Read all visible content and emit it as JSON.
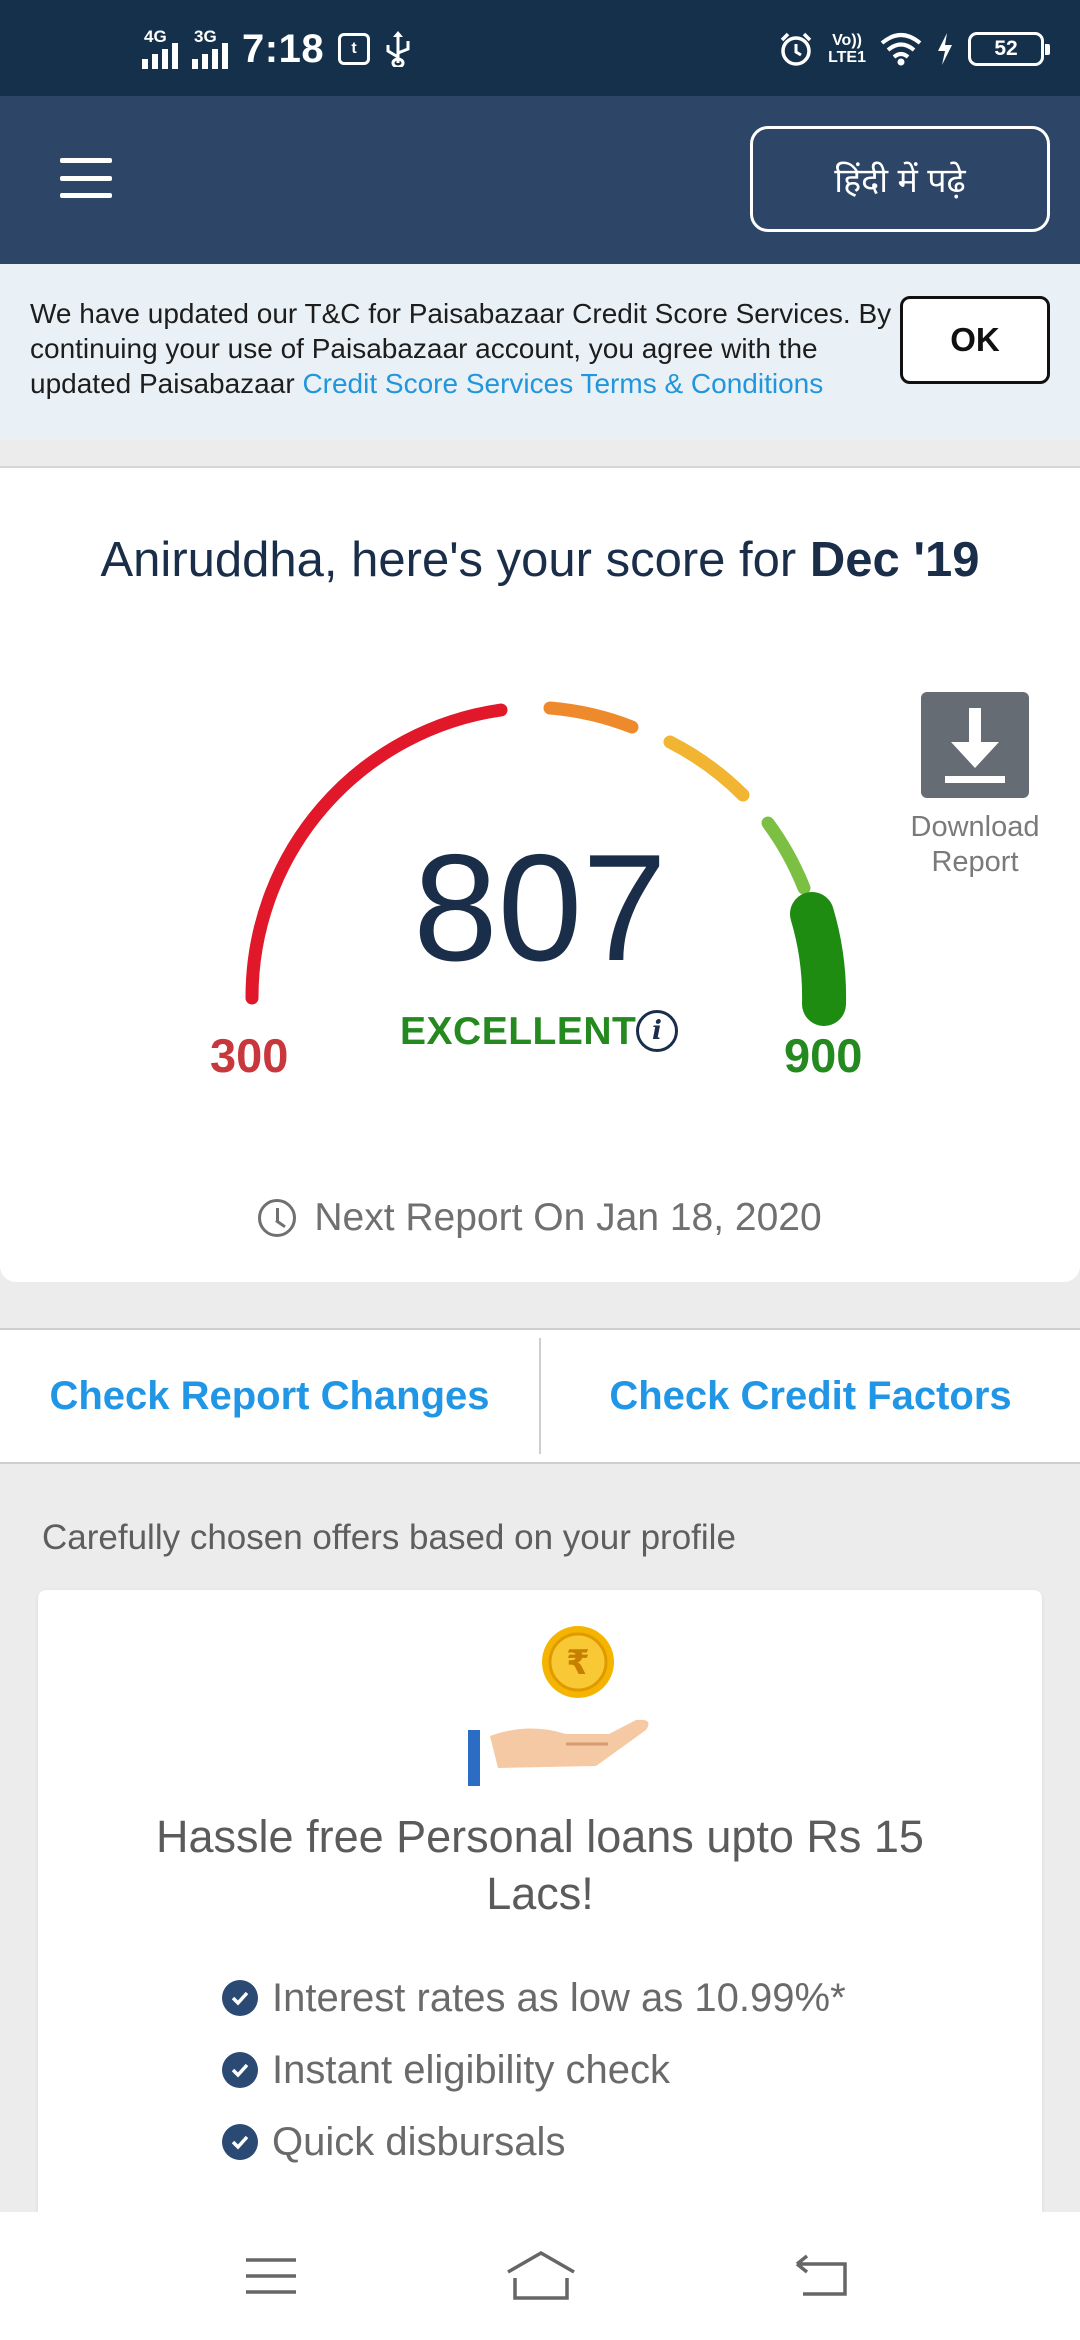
{
  "status_bar": {
    "network_1": "4G",
    "network_2": "3G",
    "time": "7:18",
    "notification_badge": "t",
    "volte_line1": "Vo))",
    "volte_line2": "LTE1",
    "battery_level": "52"
  },
  "header": {
    "language_button": "हिंदी में पढ़े",
    "menu_icon": "hamburger-icon"
  },
  "tnc_banner": {
    "text": "We have updated our T&C for Paisabazaar Credit Score Services. By continuing your use of Paisabazaar account, you agree with the updated Paisabazaar ",
    "link_text": "Credit Score Services Terms & Conditions",
    "ok_label": "OK"
  },
  "score_card": {
    "title_prefix": "Aniruddha, here's your score for ",
    "title_month": "Dec '19",
    "score": "807",
    "rating": "EXCELLENT",
    "min": "300",
    "max": "900",
    "download_label": "Download Report",
    "next_report": "Next Report On Jan 18, 2020",
    "score_fraction": 0.845
  },
  "check_links": {
    "report_changes": "Check Report Changes",
    "credit_factors": "Check Credit Factors"
  },
  "offers": {
    "heading": "Carefully chosen offers based on your profile",
    "card_title": "Hassle free Personal loans upto Rs 15 Lacs!",
    "benefits": [
      "Interest rates as low as 10.99%*",
      "Instant eligibility check",
      "Quick disbursals"
    ]
  },
  "colors": {
    "status_bar": "#15304a",
    "header": "#2d4566",
    "link_blue": "#2196e6",
    "gauge_red": "#e0182a",
    "gauge_orange": "#ef8a2c",
    "gauge_yellow": "#f2b531",
    "gauge_lightgreen": "#7cc043",
    "gauge_green": "#1e8c10"
  }
}
